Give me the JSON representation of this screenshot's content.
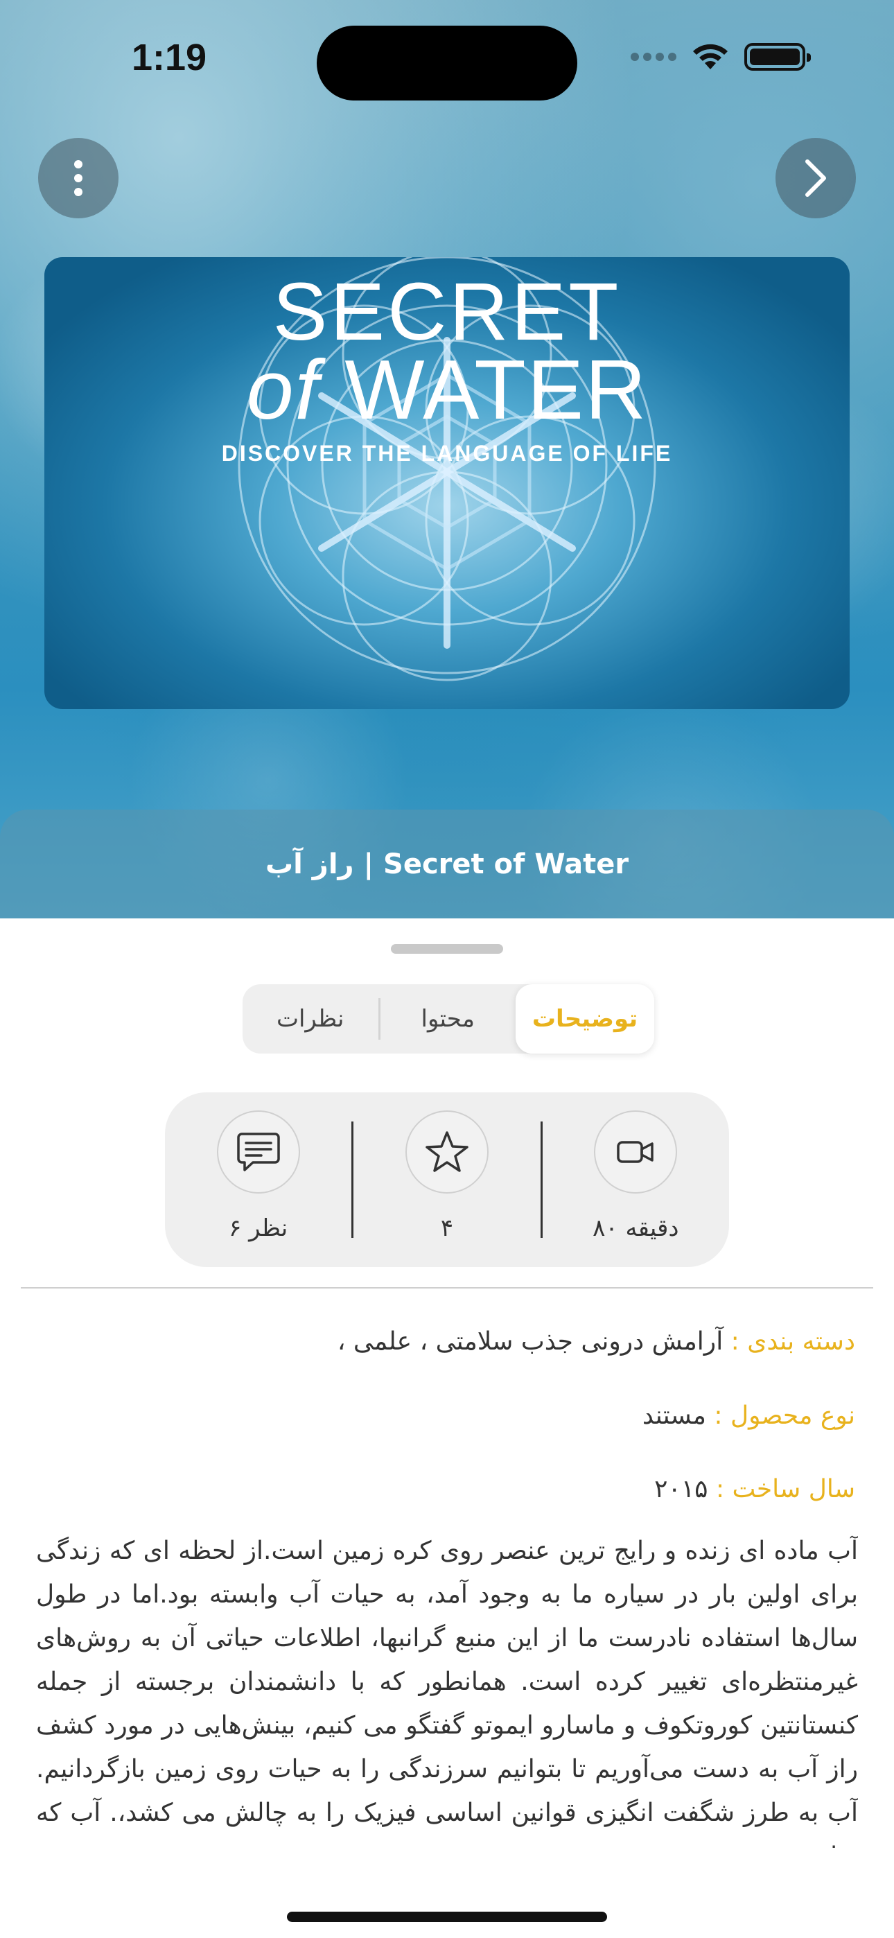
{
  "status_bar": {
    "time": "1:19"
  },
  "header": {
    "menu_icon": "vertical-ellipsis-icon",
    "next_icon": "chevron-right-icon"
  },
  "poster": {
    "line1": "SECRET",
    "line2_prefix": "of",
    "line2_word": "WATER",
    "tagline": "DISCOVER THE LANGUAGE OF LIFE"
  },
  "title": "راز آب | Secret of Water",
  "tabs": [
    {
      "label": "توضیحات",
      "active": true
    },
    {
      "label": "محتوا",
      "active": false
    },
    {
      "label": "نظرات",
      "active": false
    }
  ],
  "stats": {
    "duration": {
      "icon": "video-camera-icon",
      "label": "۸۰ دقیقه"
    },
    "rating": {
      "icon": "star-icon",
      "label": "۴"
    },
    "comments": {
      "icon": "comment-icon",
      "label": "۶ نظر"
    }
  },
  "details": {
    "category_key": "دسته بندی :",
    "category_value": "آرامش درونی  جذب سلامتی ، علمی ،",
    "type_key": "نوع محصول :",
    "type_value": "مستند",
    "year_key": "سال ساخت :",
    "year_value": "۲۰۱۵"
  },
  "description": "آب ماده ای زنده و رایج ترین عنصر روی کره زمین است.از لحظه ای که زندگی برای اولین بار در سیاره ما به وجود آمد، به حیات آب وابسته بود.اما در طول سال‌ها استفاده نادرست ما از این منبع گرانبها، اطلاعات حیاتی آن به روش‌های غیرمنتظره‌ای تغییر کرده است. همانطور که با دانشمندان برجسته از جمله کنستانتین کوروتکوف و ماسارو ایموتو گفتگو می کنیم، بینش‌هایی در مورد کشف راز آب به دست می‌آوریم تا بتوانیم سرزندگی را به حیات روی زمین بازگردانیم. آب به طرز شگفت انگیزی قوانین اساسی فیزیک را به چالش می کشد،. آب که برای",
  "colors": {
    "accent": "#e8b21d",
    "segment_bg": "#efefef",
    "text": "#333333"
  }
}
